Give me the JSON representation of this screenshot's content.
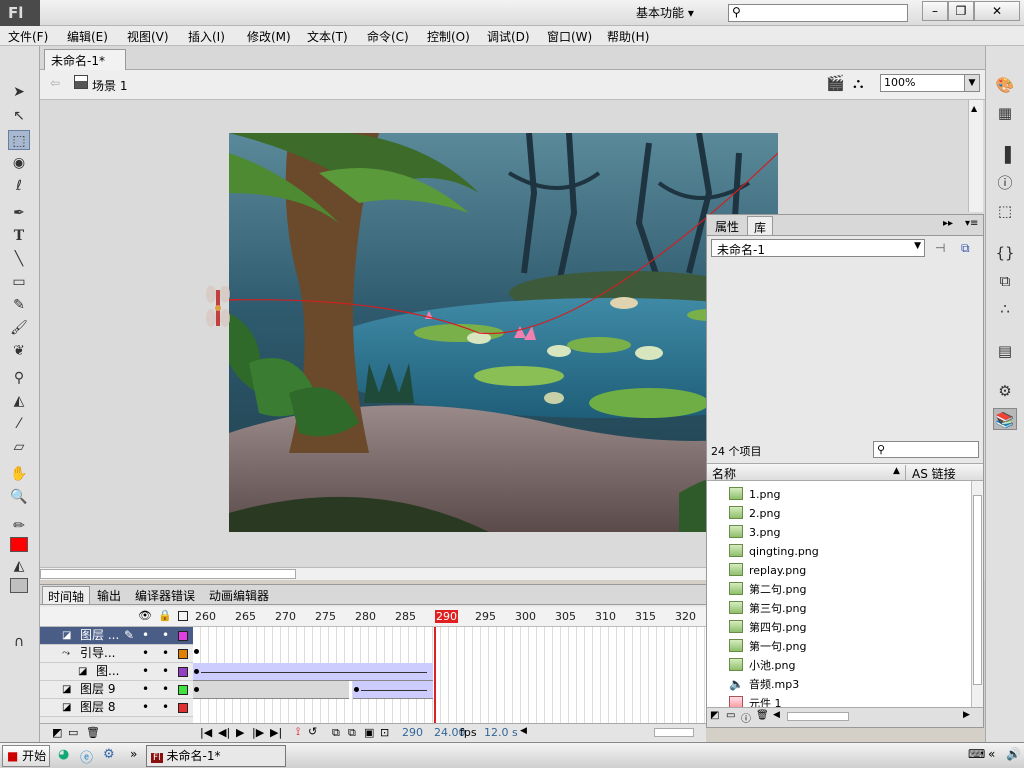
{
  "app": {
    "logo": "Fl"
  },
  "titlebar": {
    "workspace": "基本功能",
    "workspace_arrow": "▾",
    "search_placeholder": "",
    "min": "–",
    "max": "❐",
    "close": "✕"
  },
  "menus": [
    "文件(F)",
    "编辑(E)",
    "视图(V)",
    "插入(I)",
    "修改(M)",
    "文本(T)",
    "命令(C)",
    "控制(O)",
    "调试(D)",
    "窗口(W)",
    "帮助(H)"
  ],
  "document": {
    "tab_title": "未命名-1*",
    "tab_close": "×",
    "scene": "场景 1",
    "zoom": "100%"
  },
  "library": {
    "tabs": [
      "属性",
      "库"
    ],
    "selected_doc": "未命名-1",
    "count": "24 个项目",
    "col_name": "名称",
    "col_link": "AS 链接",
    "items": [
      {
        "name": "1.png",
        "type": "bitmap"
      },
      {
        "name": "2.png",
        "type": "bitmap"
      },
      {
        "name": "3.png",
        "type": "bitmap"
      },
      {
        "name": "qingting.png",
        "type": "bitmap"
      },
      {
        "name": "replay.png",
        "type": "bitmap"
      },
      {
        "name": "第二句.png",
        "type": "bitmap"
      },
      {
        "name": "第三句.png",
        "type": "bitmap"
      },
      {
        "name": "第四句.png",
        "type": "bitmap"
      },
      {
        "name": "第一句.png",
        "type": "bitmap"
      },
      {
        "name": "小池.png",
        "type": "bitmap"
      },
      {
        "name": "音频.mp3",
        "type": "sound"
      },
      {
        "name": "元件 1",
        "type": "symbol"
      }
    ]
  },
  "timeline": {
    "tabs": [
      "时间轴",
      "输出",
      "编译器错误",
      "动画编辑器"
    ],
    "ruler": [
      "260",
      "265",
      "270",
      "275",
      "280",
      "285",
      "290",
      "295",
      "300",
      "305",
      "310",
      "315",
      "320"
    ],
    "layers": [
      {
        "name": "图层 ...",
        "color": "#e040e0",
        "selected": true
      },
      {
        "name": "引导...",
        "color": "#e08000",
        "selected": false
      },
      {
        "name": "图...",
        "color": "#9040c0",
        "selected": false
      },
      {
        "name": "图层 9",
        "color": "#40e040",
        "selected": false
      },
      {
        "name": "图层 8",
        "color": "#e03030",
        "selected": false
      }
    ],
    "current_frame": "290",
    "fps": "24.00",
    "fps_unit": "fps",
    "time": "12.0 s"
  },
  "taskbar": {
    "start": "开始",
    "task": "未命名-1*",
    "chevron": "»"
  },
  "colors": {
    "stroke": "#000000",
    "fill": "#ff0000"
  }
}
